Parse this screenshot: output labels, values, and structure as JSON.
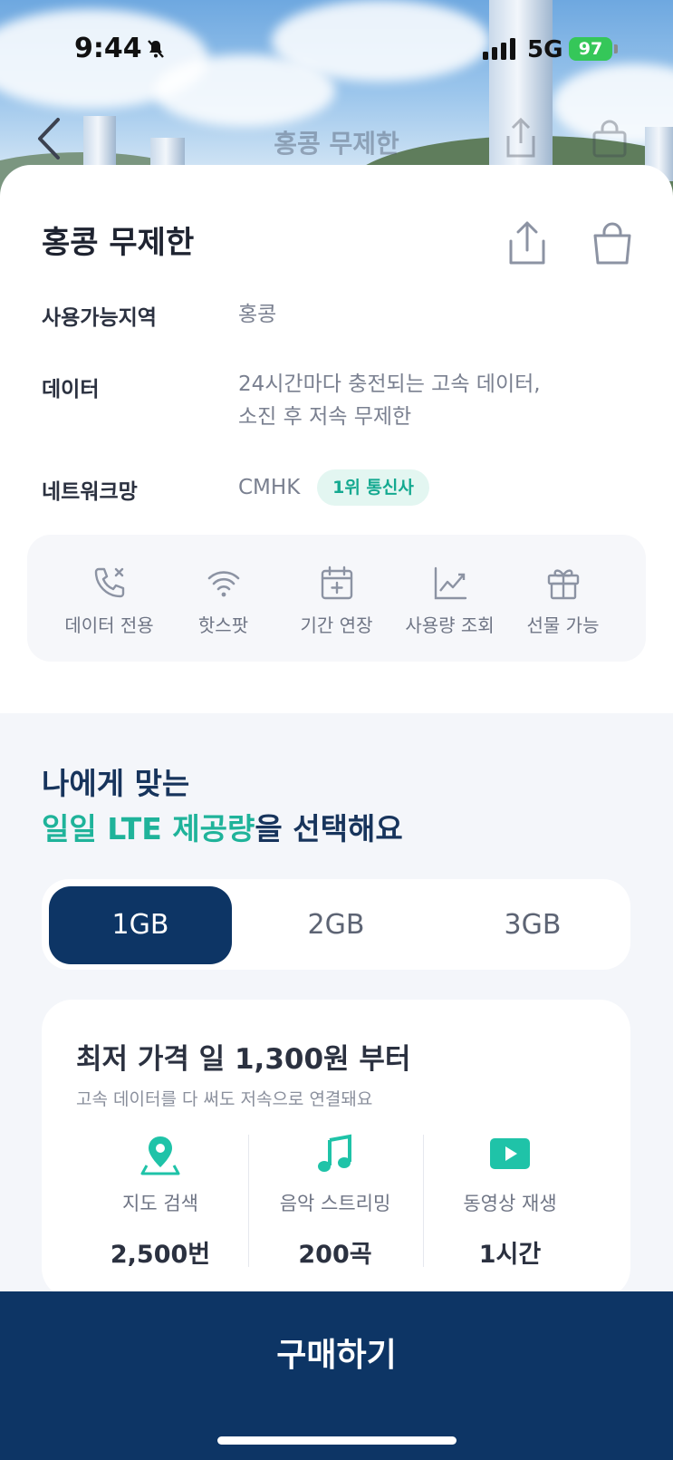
{
  "status_bar": {
    "time": "9:44",
    "network": "5G",
    "battery": "97"
  },
  "nav": {
    "title": "홍콩 무제한",
    "back_icon": "chevron-left-icon"
  },
  "product": {
    "title": "홍콩 무제한",
    "rows": [
      {
        "label": "사용가능지역",
        "value_lines": [
          "홍콩"
        ]
      },
      {
        "label": "데이터",
        "value_lines": [
          "24시간마다 충전되는 고속 데이터,",
          "소진 후 저속 무제한"
        ]
      },
      {
        "label": "네트워크망",
        "value_lines": [
          "CMHK"
        ],
        "badge": "1위 통신사"
      }
    ]
  },
  "features": [
    {
      "icon": "phone-off-icon",
      "label": "데이터 전용"
    },
    {
      "icon": "wifi-icon",
      "label": "핫스팟"
    },
    {
      "icon": "calendar-plus-icon",
      "label": "기간 연장"
    },
    {
      "icon": "chart-line-icon",
      "label": "사용량 조회"
    },
    {
      "icon": "gift-icon",
      "label": "선물 가능"
    }
  ],
  "section": {
    "line1": "나에게 맞는",
    "accent": "일일 LTE 제공량",
    "rest": "을 선택해요"
  },
  "plans": {
    "options": [
      "1GB",
      "2GB",
      "3GB"
    ],
    "selected": "1GB"
  },
  "price": {
    "title": "최저 가격 일 1,300원 부터",
    "subtitle": "고속 데이터를 다 써도 저속으로 연결돼요",
    "usages": [
      {
        "icon": "map-pin-icon",
        "label": "지도 검색",
        "value": "2,500번"
      },
      {
        "icon": "music-note-icon",
        "label": "음악 스트리밍",
        "value": "200곡"
      },
      {
        "icon": "play-video-icon",
        "label": "동영상 재생",
        "value": "1시간"
      }
    ]
  },
  "cta": {
    "label": "구매하기"
  },
  "colors": {
    "navy": "#0d3565",
    "teal": "#1fb39a",
    "badge_bg": "#e3f6f1"
  }
}
